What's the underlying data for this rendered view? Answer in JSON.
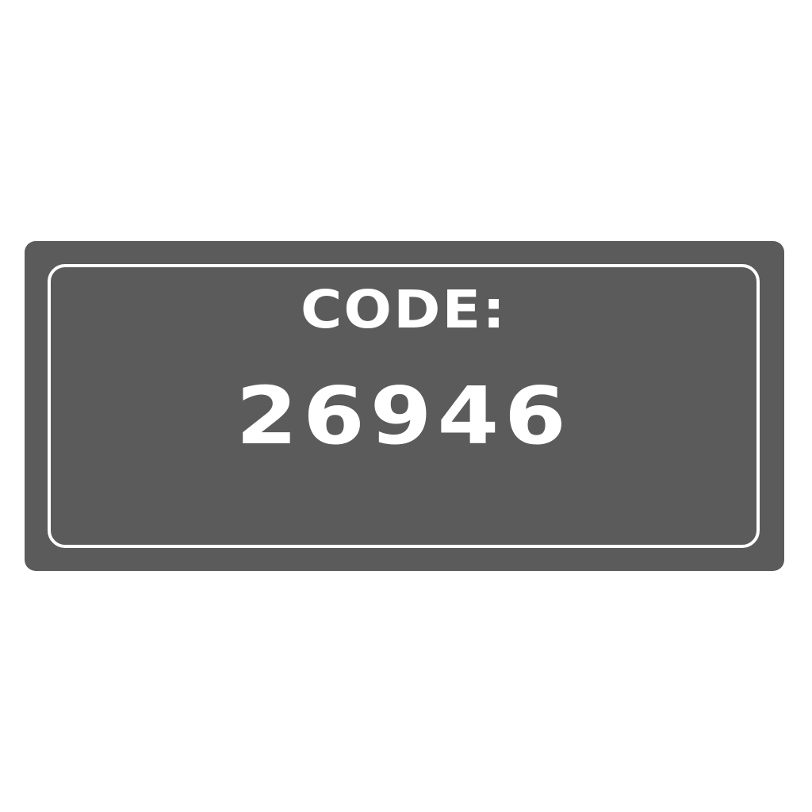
{
  "sign": {
    "label": "CODE:",
    "code": "26946"
  },
  "colors": {
    "background": "#ffffff",
    "plate": "#5b5b5b",
    "text": "#ffffff",
    "border": "#ffffff"
  }
}
